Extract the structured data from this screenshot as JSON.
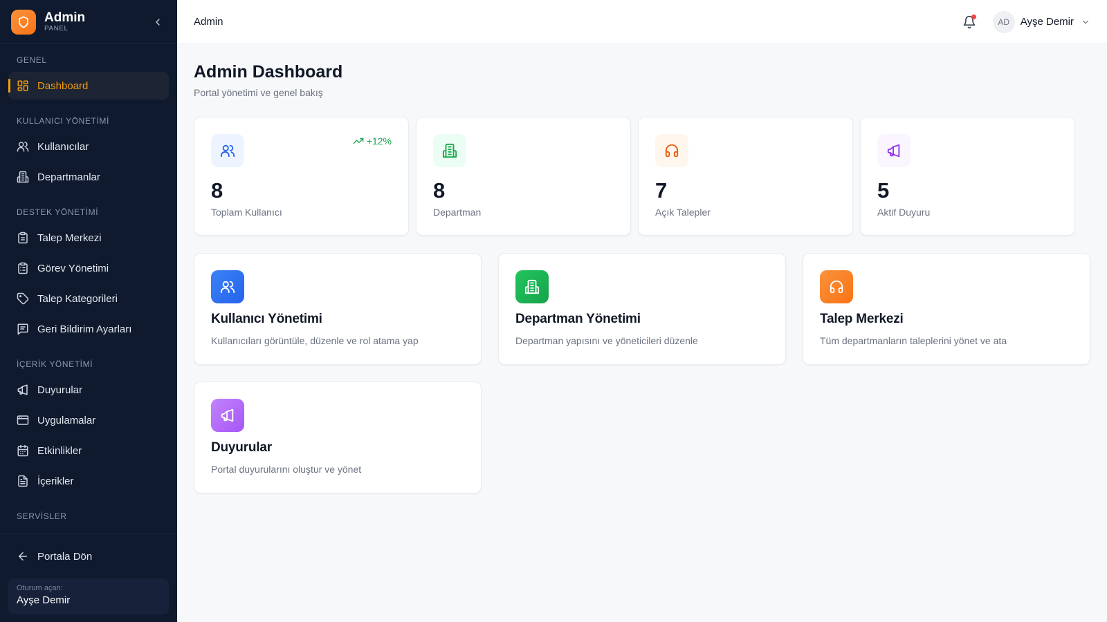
{
  "brand": {
    "title": "Admin",
    "subtitle": "PANEL"
  },
  "sidebar": {
    "sections": [
      {
        "title": "GENEL"
      },
      {
        "title": "KULLANICI YÖNETİMİ"
      },
      {
        "title": "DESTEK YÖNETİMİ"
      },
      {
        "title": "İÇERİK YÖNETİMİ"
      },
      {
        "title": "SERVİSLER"
      }
    ],
    "items": [
      {
        "label": "Dashboard",
        "icon": "dashboard-icon",
        "active": true
      },
      {
        "label": "Kullanıcılar",
        "icon": "users-icon"
      },
      {
        "label": "Departmanlar",
        "icon": "building-icon"
      },
      {
        "label": "Talep Merkezi",
        "icon": "clipboard-icon"
      },
      {
        "label": "Görev Yönetimi",
        "icon": "clipboard-list-icon"
      },
      {
        "label": "Talep Kategorileri",
        "icon": "tag-icon"
      },
      {
        "label": "Geri Bildirim Ayarları",
        "icon": "message-square-icon"
      },
      {
        "label": "Duyurular",
        "icon": "megaphone-icon"
      },
      {
        "label": "Uygulamalar",
        "icon": "app-window-icon"
      },
      {
        "label": "Etkinlikler",
        "icon": "calendar-icon"
      },
      {
        "label": "İçerikler",
        "icon": "file-text-icon"
      }
    ],
    "back_label": "Portala Dön",
    "session_label": "Oturum açan:",
    "session_user": "Ayşe Demir"
  },
  "topbar": {
    "title": "Admin",
    "avatar_initials": "AD",
    "user_name": "Ayşe Demir"
  },
  "page": {
    "title": "Admin Dashboard",
    "subtitle": "Portal yönetimi ve genel bakış"
  },
  "stats": [
    {
      "value": "8",
      "label": "Toplam Kullanıcı",
      "trend": "+12%",
      "icon": "users-icon",
      "color": "#2563eb",
      "bg": "#eef4ff"
    },
    {
      "value": "8",
      "label": "Departman",
      "icon": "building-icon",
      "color": "#16a34a",
      "bg": "#ecfdf3"
    },
    {
      "value": "7",
      "label": "Açık Talepler",
      "icon": "headphones-icon",
      "color": "#ea580c",
      "bg": "#fff7ed"
    },
    {
      "value": "5",
      "label": "Aktif Duyuru",
      "icon": "megaphone-icon",
      "color": "#9333ea",
      "bg": "#faf5ff"
    }
  ],
  "modules": [
    {
      "title": "Kullanıcı Yönetimi",
      "desc": "Kullanıcıları görüntüle, düzenle ve rol atama yap",
      "icon": "users-icon",
      "color": "#2563eb"
    },
    {
      "title": "Departman Yönetimi",
      "desc": "Departman yapısını ve yöneticileri düzenle",
      "icon": "building-icon",
      "color": "#16a34a"
    },
    {
      "title": "Talep Merkezi",
      "desc": "Tüm departmanların taleplerini yönet ve ata",
      "icon": "headphones-icon",
      "color": "#f97316"
    },
    {
      "title": "Duyurular",
      "desc": "Portal duyurularını oluştur ve yönet",
      "icon": "megaphone-icon",
      "color": "#a855f7"
    }
  ]
}
